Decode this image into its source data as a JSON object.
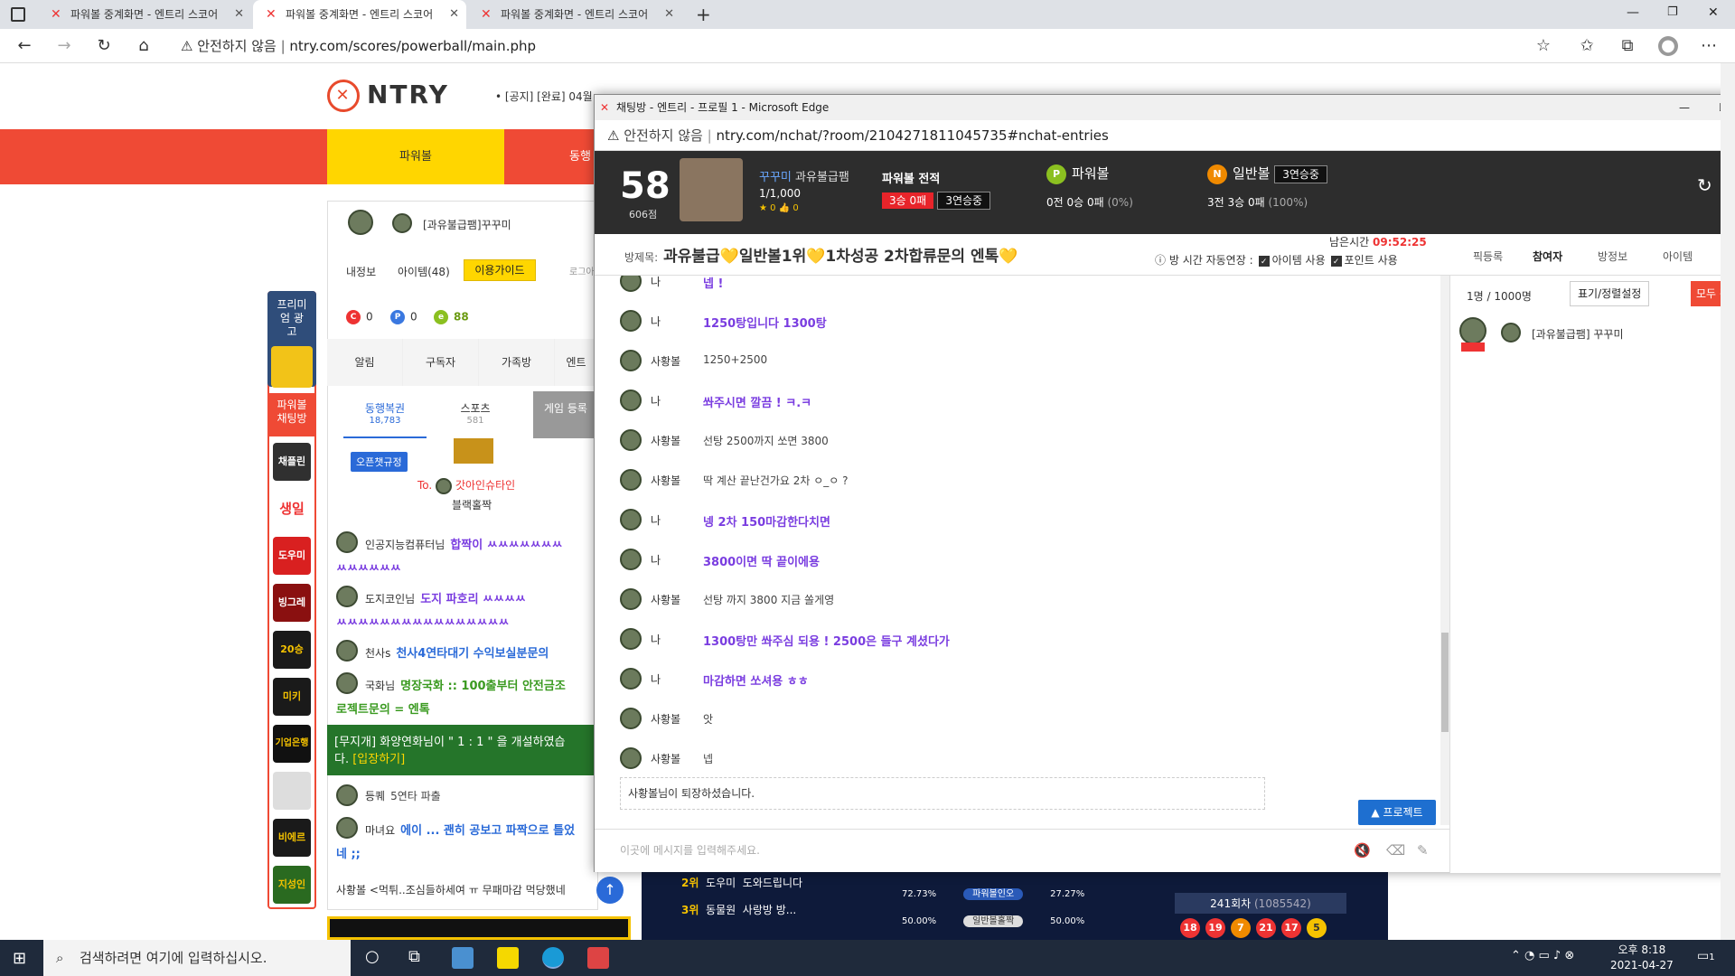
{
  "browser": {
    "tabs": [
      {
        "label": "파워볼 중계화면 - 엔트리 스코어"
      },
      {
        "label": "파워볼 중계화면 - 엔트리 스코어"
      },
      {
        "label": "파워볼 중계화면 - 엔트리 스코어"
      }
    ],
    "security": "안전하지 않음",
    "url": "ntry.com/scores/powerball/main.php"
  },
  "site": {
    "logo": "NTRY",
    "notice": "• [공지] [완료] 04월",
    "menu": [
      "파워볼",
      "동행"
    ],
    "premium_ad": "프리미엄 광고",
    "chat_label": "파워볼 채팅방",
    "side_icons": [
      "채플린",
      "생일",
      "도우미",
      "빙그레",
      "20승",
      "미키",
      "기업은행",
      "",
      "비에르",
      "지성인"
    ]
  },
  "left_panel": {
    "user": "[과유불급팸]꾸꾸미",
    "tabs": [
      "내정보",
      "아이템(48)",
      "이용가이드"
    ],
    "login_hint": "로그아",
    "points": [
      "0",
      "0",
      "88"
    ],
    "row": [
      "알림",
      "구독자",
      "가족방",
      "엔트"
    ],
    "subtabs": [
      {
        "label": "동행복권",
        "count": "18,783"
      },
      {
        "label": "스포츠",
        "count": "581"
      },
      {
        "label": "게임\n등록"
      }
    ],
    "open_chat": "오픈챗규정",
    "gift_to": "To.",
    "gift_name": "갓아인슈타인",
    "gift_label": "블랙홀짝",
    "chat": [
      {
        "nick": "인공지능컴퓨터님",
        "msg": "합짝이 ㅆㅆㅆㅆㅆㅆㅆ"
      },
      {
        "nick": "",
        "msg": "ㅆㅆㅆㅆㅆㅆ"
      },
      {
        "nick": "도지코인님",
        "msg": "도지 파호리 ㅆㅆㅆㅆ"
      },
      {
        "nick": "",
        "msg": "ㅆㅆㅆㅆㅆㅆㅆㅆㅆㅆㅆㅆㅆㅆㅆㅆ"
      },
      {
        "nick": "천사s",
        "msg": "천사4연타대기 수익보실분문의"
      },
      {
        "nick": "국화님",
        "msg": "명장국화 :: 100출부터 안전금조"
      },
      {
        "nick": "",
        "msg": "로젝트문의 = 엔톡"
      }
    ],
    "green_notice_a": "[무지개] 화양연화님이 \" 1 : 1 \" 을 개설하였습",
    "green_notice_b": "다. ",
    "green_enter": "[입장하기]",
    "chat2": [
      {
        "nick": "등퀘",
        "msg": "5연타 파출"
      },
      {
        "nick": "마녀요",
        "msg": "에이 ... 괜히 공보고 파짝으로 틀었"
      },
      {
        "nick": "",
        "msg": "네 ;;"
      }
    ],
    "bottom_line": "사황볼 <먹튀..조심들하세여 ㅠ 무패마감 먹당했네"
  },
  "popup": {
    "title": "채팅방 - 엔트리 - 프로필 1 - Microsoft Edge",
    "security": "안전하지 않음",
    "url": "ntry.com/nchat/?room/2104271811045735#nchat-entries",
    "score": "58",
    "score_label": "606점",
    "nick": "꾸꾸미",
    "group": "과유불급팸",
    "count": "1/1,000",
    "stars": "0",
    "thumbs": "0",
    "record_title": "파워볼 전적",
    "record_a": "3승 0패",
    "record_b": "3연승중",
    "pb_label": "파워볼",
    "pb_stats": "0전 0승 0패",
    "pb_pct": "(0%)",
    "nb_label": "일반볼",
    "nb_streak": "3연승중",
    "nb_stats": "3전 3승 0패",
    "nb_pct": "(100%)",
    "room_label": "방제목:",
    "room_title": "과유불급💛일반볼1위💛1차성공 2차합류문의 엔톡💛",
    "time_label": "남은시간",
    "time": "09:52:25",
    "options_label": "방 시간 자동연장 :",
    "opt1": "아이템 사용",
    "opt2": "포인트 사용",
    "right_tabs": [
      "픽등록",
      "참여자",
      "방정보",
      "아이템"
    ],
    "participants": "1명 / 1000명",
    "sort_btn": "표기/정렬설정",
    "all_btn": "모두 강",
    "participant_name": "[과유불급팸] 꾸꾸미",
    "messages": [
      {
        "nick": "나",
        "text": "넵 !",
        "me": true
      },
      {
        "nick": "나",
        "text": "1250탕입니다 1300탕",
        "me": true
      },
      {
        "nick": "사황볼",
        "text": "1250+2500",
        "me": false
      },
      {
        "nick": "나",
        "text": "쏴주시면 깔끔 ! ㅋ.ㅋ",
        "me": true
      },
      {
        "nick": "사황볼",
        "text": "선탕 2500까지 쏘면 3800",
        "me": false
      },
      {
        "nick": "사황볼",
        "text": "딱 계산 끝난건가요 2차 ㅇ_ㅇ ?",
        "me": false
      },
      {
        "nick": "나",
        "text": "넹 2차 150마감한다치면",
        "me": true
      },
      {
        "nick": "나",
        "text": "3800이면 딱 끝이에용",
        "me": true
      },
      {
        "nick": "사황볼",
        "text": "선탕 까지 3800 지금 쏠게영",
        "me": false
      },
      {
        "nick": "나",
        "text": "1300탕만 쏴주심 되용 ! 2500은 들구 계셨다가",
        "me": true
      },
      {
        "nick": "나",
        "text": "마감하면 쏘셔용 ㅎㅎ",
        "me": true
      },
      {
        "nick": "사황볼",
        "text": "앗",
        "me": false
      },
      {
        "nick": "사황볼",
        "text": "넵",
        "me": false
      }
    ],
    "left_notice": "사황볼님이 퇴장하셨습니다.",
    "protect": "▲ 프로젝트",
    "input_placeholder": "이곳에 메시지를 입력해주세요."
  },
  "game": {
    "rank2": "2위",
    "rank2_name": "도우미",
    "rank2_msg": "도와드립니다",
    "rank3": "3위",
    "rank3_name": "동물원",
    "rank3_msg": "사랑방 방...",
    "pb_odd": "72.73%",
    "pb_label": "파워볼인오",
    "pb_even": "27.27%",
    "nb_odd": "50.00%",
    "nb_label": "일반볼홀짝",
    "nb_even": "50.00%",
    "round": "241회차",
    "round_id": "(1085542)",
    "balls": [
      "18",
      "19",
      "7",
      "21",
      "17",
      "5"
    ]
  },
  "taskbar": {
    "search": "검색하려면 여기에 입력하십시오.",
    "time": "오후 8:18",
    "date": "2021-04-27",
    "notif": "1"
  },
  "colors": {
    "accent_red": "#ef4a35",
    "accent_yellow": "#ffd600",
    "chat_purple": "#7a3de0"
  }
}
